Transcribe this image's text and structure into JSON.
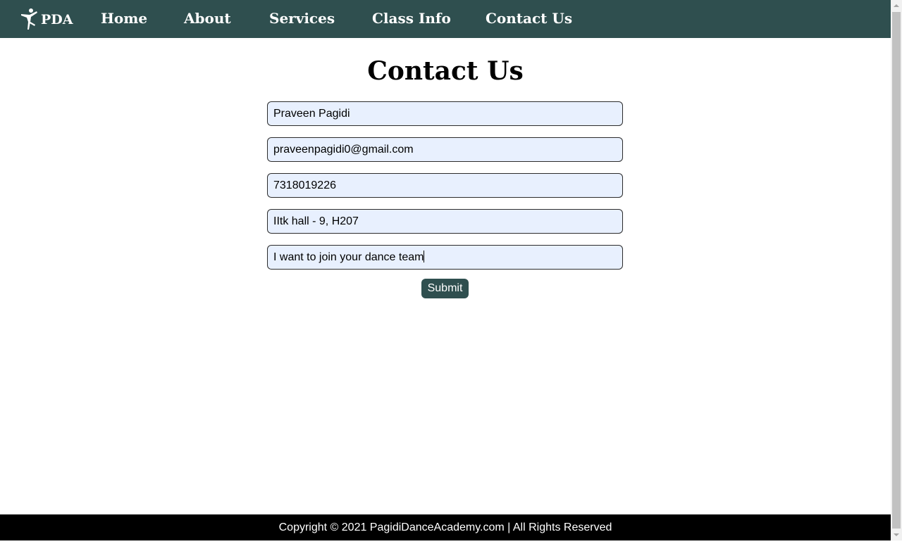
{
  "nav": {
    "logo_text": "PDA",
    "links": [
      "Home",
      "About",
      "Services",
      "Class Info",
      "Contact Us"
    ]
  },
  "page": {
    "title": "Contact Us"
  },
  "form": {
    "name_value": "Praveen Pagidi",
    "email_value": "praveenpagidi0@gmail.com",
    "phone_value": "7318019226",
    "address_value": "IItk hall - 9, H207",
    "message_value": "I want to join your dance team",
    "submit_label": "Submit"
  },
  "footer": {
    "text": "Copyright © 2021 PagidiDanceAcademy.com | All Rights Reserved"
  },
  "colors": {
    "nav_bg": "#2f4f4f",
    "field_bg": "#e8f0fe",
    "footer_bg": "#000000"
  }
}
